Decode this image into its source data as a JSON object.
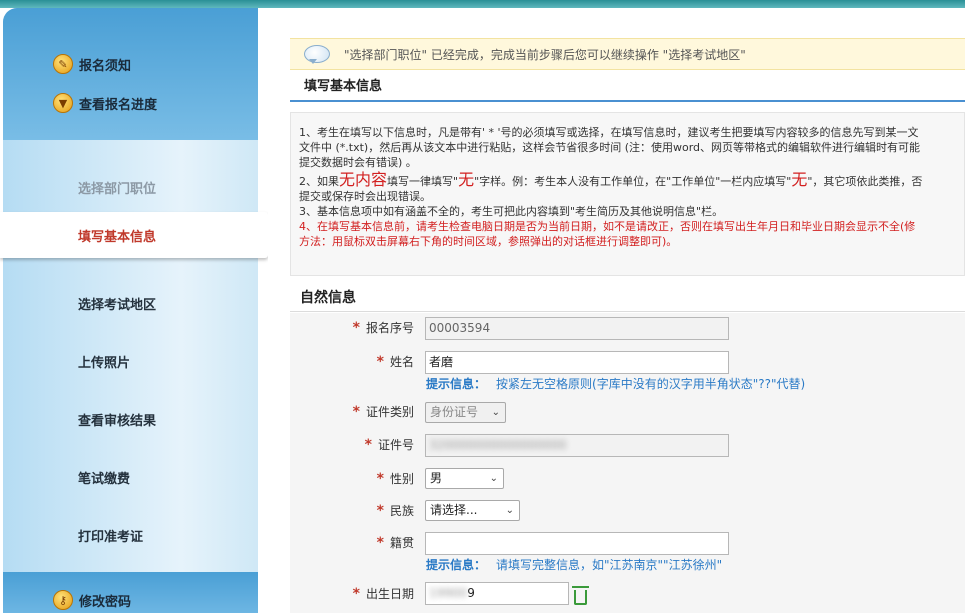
{
  "sidebar": {
    "top_links": [
      {
        "label": "报名须知",
        "icon": "pencil-icon"
      },
      {
        "label": "查看报名进度",
        "icon": "download-icon"
      }
    ],
    "steps": [
      {
        "label": "选择部门职位",
        "state": "done"
      },
      {
        "label": "填写基本信息",
        "state": "active"
      },
      {
        "label": "选择考试地区",
        "state": "normal"
      },
      {
        "label": "上传照片",
        "state": "normal"
      },
      {
        "label": "查看审核结果",
        "state": "normal"
      },
      {
        "label": "笔试缴费",
        "state": "normal"
      },
      {
        "label": "打印准考证",
        "state": "normal"
      }
    ],
    "bottom_link": {
      "label": "修改密码",
      "icon": "key-icon"
    }
  },
  "notice": {
    "text": "\"选择部门职位\" 已经完成，完成当前步骤后您可以继续操作 \"选择考试地区\""
  },
  "section_title": "填写基本信息",
  "instructions": {
    "l1a": "1、考生在填写以下信息时，凡是带有' * '号的必须填写或选择，在填写信息时，建议考生把要填写内容较多的信息先写到某一文",
    "l1b": "文件中 (*.txt)，然后再从该文本中进行粘贴，这样会节省很多时间 (注：使用word、网页等带格式的编辑软件进行编辑时有可能",
    "l1c": "提交数据时会有错误) 。",
    "l2a_pre": "2、如果",
    "l2a_big1": "无内容",
    "l2a_mid": "填写一律填写\"",
    "l2a_big2": "无",
    "l2a_mid2": "\"字样。例：考生本人没有工作单位，在\"工作单位\"一栏内应填写\"",
    "l2a_big3": "无",
    "l2a_post": "\"，其它项依此类推，否",
    "l2b": "提交或保存时会出现错误。",
    "l3": "3、基本信息项中如有涵盖不全的，考生可把此内容填到\"考生简历及其他说明信息\"栏。",
    "l4a_pre": "4、",
    "l4a": "在填写基本信息前，请考生检查电脑日期是否为当前日期，如不是请改正，否则在填写出生年月日和毕业日期会显示不全(修",
    "l4b": "方法：用鼠标双击屏幕右下角的时间区域，参照弹出的对话框进行调整即可)。"
  },
  "form_title": "自然信息",
  "form": {
    "reg_no_label": "报名序号",
    "reg_no_value": "00003594",
    "name_label": "姓名",
    "name_value": "者磨",
    "name_hint_title": "提示信息：",
    "name_hint": "按紧左无空格原则(字库中没有的汉字用半角状态\"??\"代替)",
    "id_type_label": "证件类别",
    "id_type_value": "身份证号",
    "id_no_label": "证件号",
    "id_no_value": "320000000000000000",
    "gender_label": "性别",
    "gender_value": "男",
    "ethnic_label": "民族",
    "ethnic_value": "请选择...",
    "native_label": "籍贯",
    "native_value": "",
    "native_hint_title": "提示信息：",
    "native_hint": "请填写完整信息，如\"江苏南京\"\"江苏徐州\"",
    "birth_label": "出生日期",
    "birth_value_hidden": "19900",
    "birth_value_tail": "9"
  },
  "colors": {
    "accent": "#4a90d1",
    "required": "#c0392b",
    "hint": "#2a7ac6",
    "active_step": "#c0392b"
  }
}
